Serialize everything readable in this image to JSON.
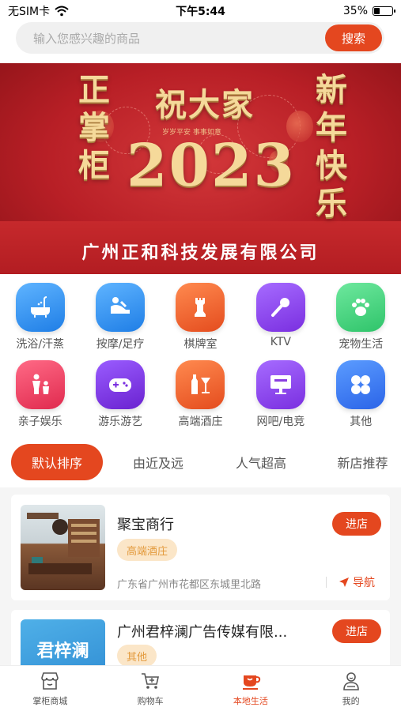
{
  "status_bar": {
    "carrier": "无SIM卡",
    "time": "下午5:44",
    "battery_percent": "35%",
    "battery_level": 0.35
  },
  "search": {
    "placeholder": "输入您感兴趣的商品",
    "button_label": "搜索"
  },
  "banner": {
    "left_text": [
      "正",
      "掌",
      "柜"
    ],
    "headline": "祝大家",
    "subline": "岁岁平安 事事如意",
    "year": "2023",
    "right_text": [
      "新",
      "年",
      "快",
      "乐"
    ],
    "company": "广州正和科技发展有限公司"
  },
  "categories": [
    {
      "label": "洗浴/汗蒸",
      "icon": "bathtub-icon",
      "color": "#2f8ee9"
    },
    {
      "label": "按摩/足疗",
      "icon": "massage-icon",
      "color": "#2f8ee9"
    },
    {
      "label": "棋牌室",
      "icon": "chess-icon",
      "color": "#ee5a2a"
    },
    {
      "label": "KTV",
      "icon": "microphone-icon",
      "color": "#8a3ee0"
    },
    {
      "label": "宠物生活",
      "icon": "paw-icon",
      "color": "#3fcf7a"
    },
    {
      "label": "亲子娱乐",
      "icon": "parent-child-icon",
      "color": "#e83a5a"
    },
    {
      "label": "游乐游艺",
      "icon": "gamepad-icon",
      "color": "#7b2fd8"
    },
    {
      "label": "高端酒庄",
      "icon": "wine-icon",
      "color": "#ee5a2a"
    },
    {
      "label": "网吧/电竞",
      "icon": "monitor-icon",
      "color": "#8a3ee0"
    },
    {
      "label": "其他",
      "icon": "grid-icon",
      "color": "#2f6ff0"
    }
  ],
  "sort_tabs": [
    {
      "label": "默认排序",
      "active": true
    },
    {
      "label": "由近及远",
      "active": false
    },
    {
      "label": "人气超高",
      "active": false
    },
    {
      "label": "新店推荐",
      "active": false
    }
  ],
  "shops": [
    {
      "name": "聚宝商行",
      "tag": "高端酒庄",
      "address": "广东省广州市花都区东城里北路",
      "nav_label": "导航",
      "enter_label": "进店"
    },
    {
      "name": "广州君梓澜广告传媒有限...",
      "tag": "其他",
      "thumb_text": "君梓澜",
      "enter_label": "进店"
    }
  ],
  "tab_bar": [
    {
      "label": "掌柜商城",
      "icon": "shop-icon",
      "active": false
    },
    {
      "label": "购物车",
      "icon": "cart-icon",
      "active": false
    },
    {
      "label": "本地生活",
      "icon": "local-life-icon",
      "active": true
    },
    {
      "label": "我的",
      "icon": "profile-icon",
      "active": false
    }
  ],
  "colors": {
    "accent": "#e4471f",
    "tag_background": "#fbe6c8",
    "tag_text": "#e39a3c",
    "banner_red": "#b81f26"
  }
}
